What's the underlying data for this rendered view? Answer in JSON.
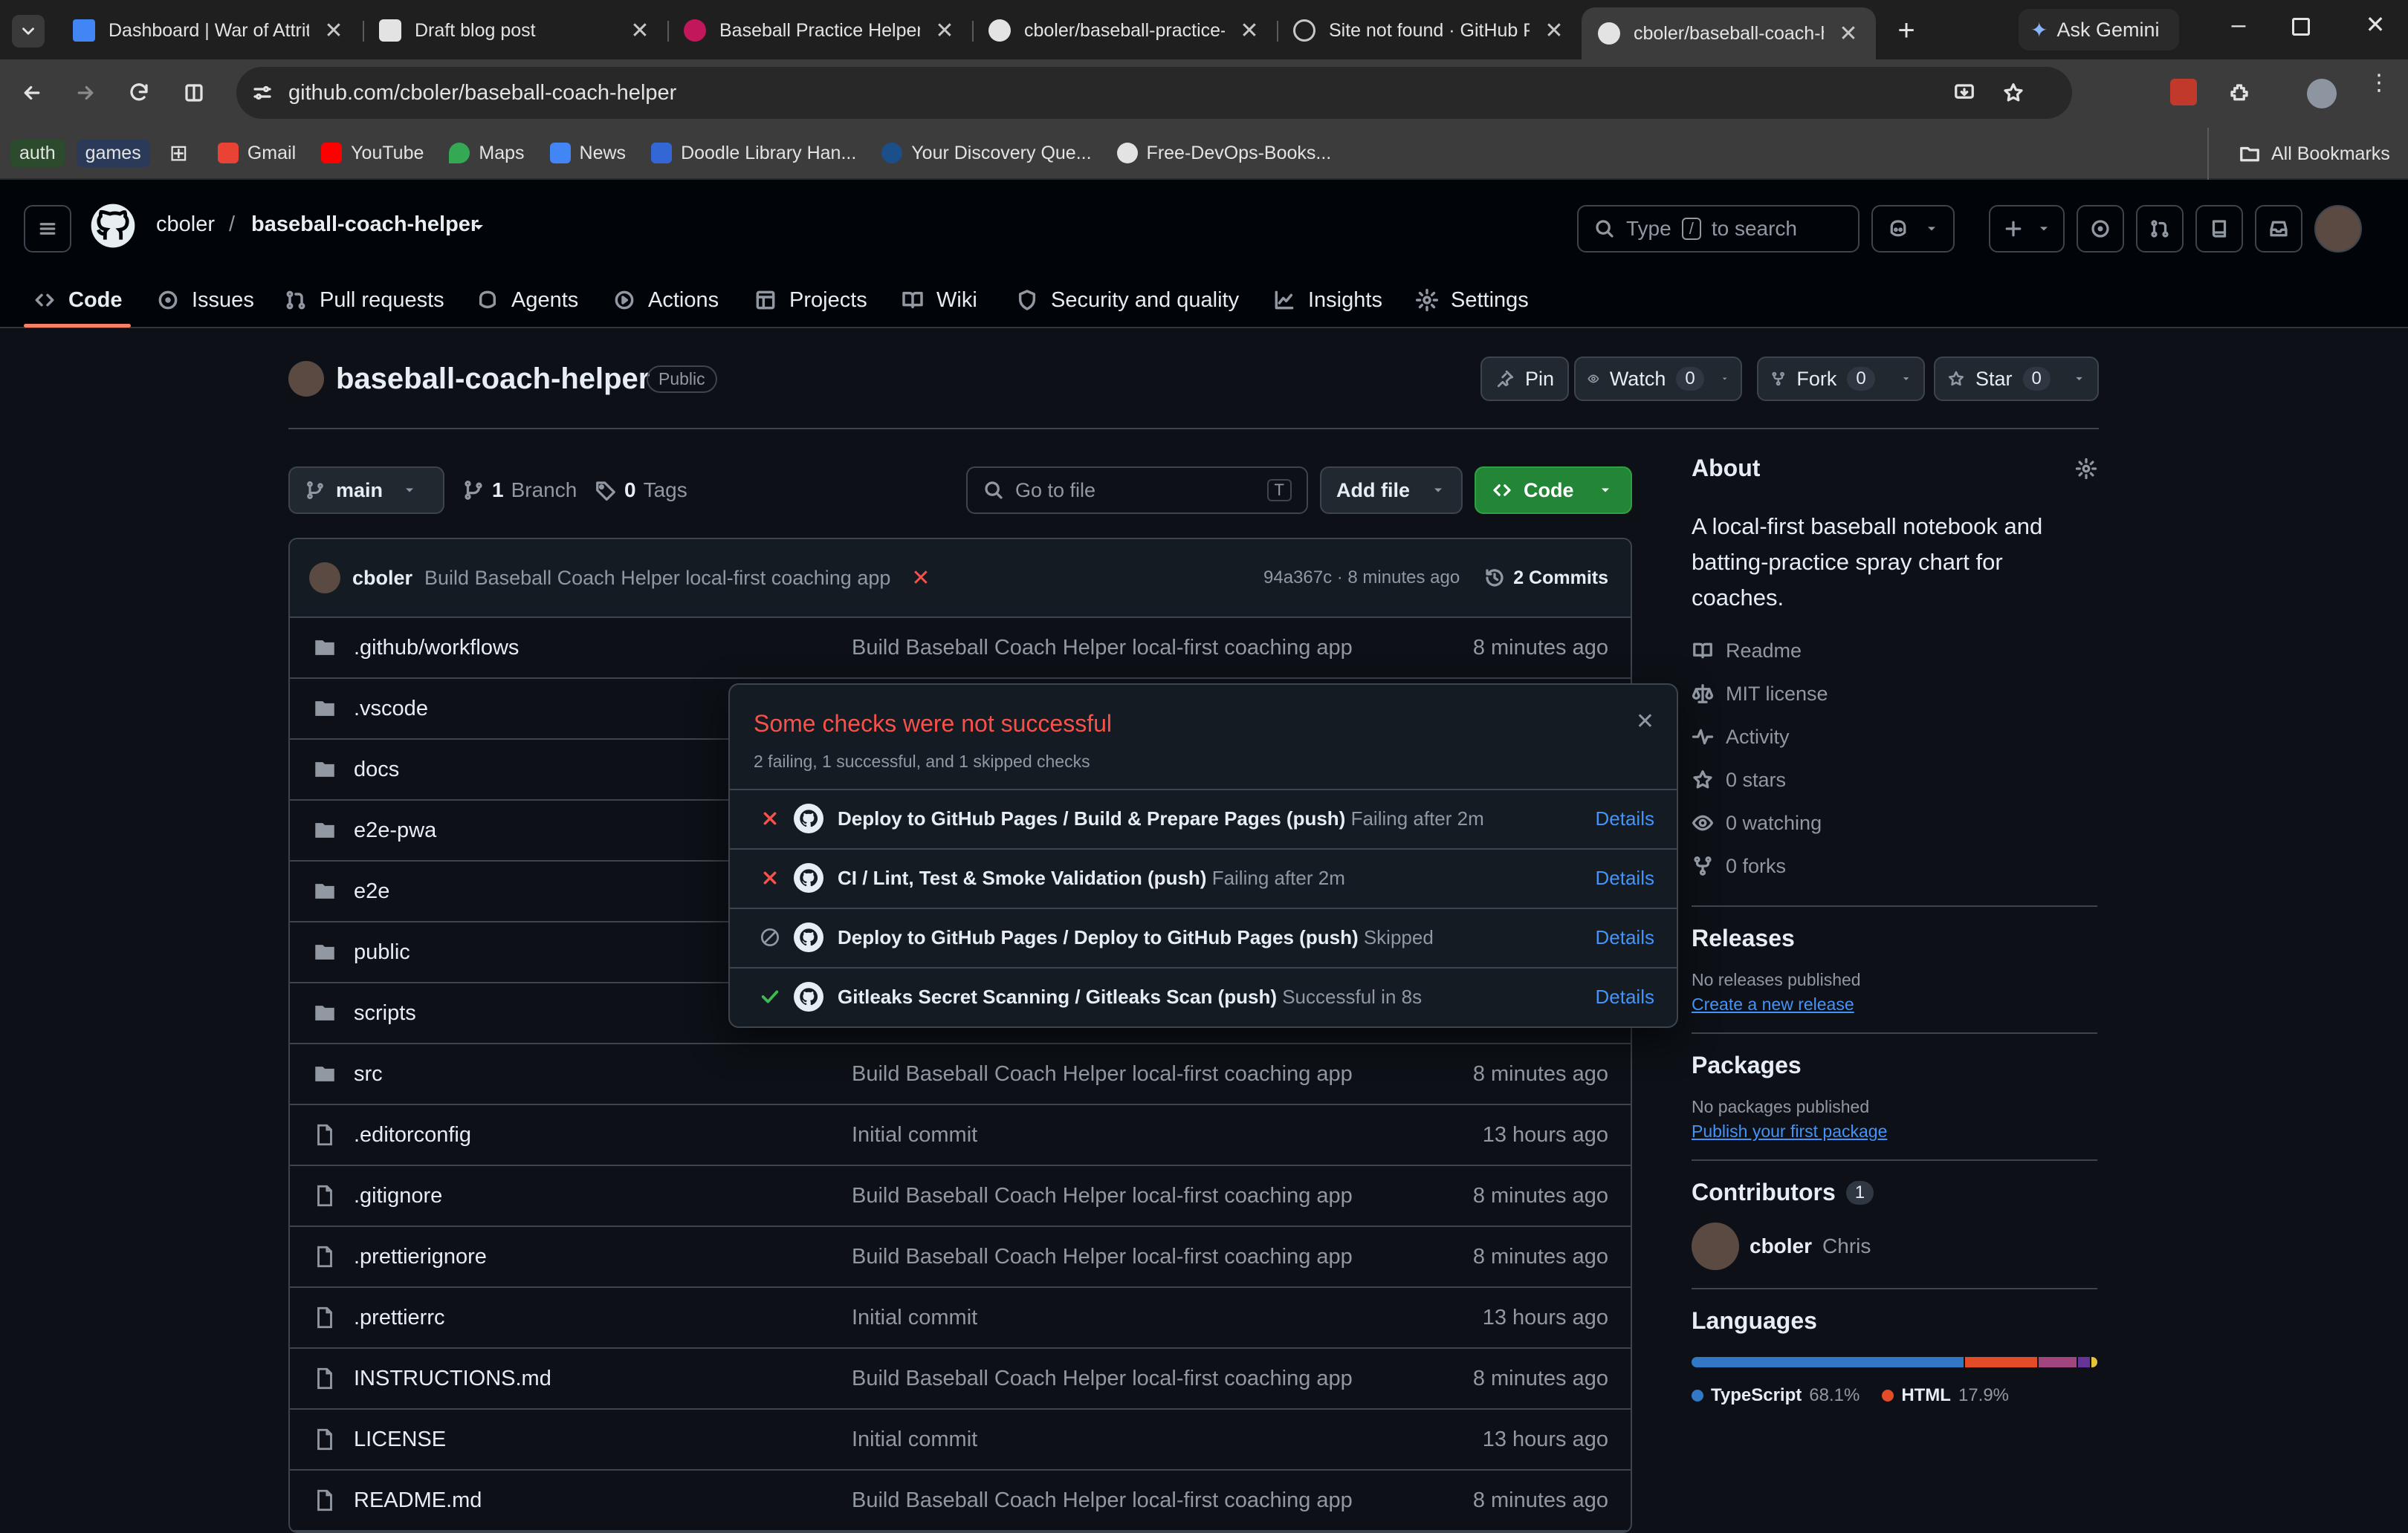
{
  "browser": {
    "tabs": [
      {
        "title": "Dashboard | War of Attrit",
        "active": false
      },
      {
        "title": "Draft blog post",
        "active": false
      },
      {
        "title": "Baseball Practice Helper",
        "active": false
      },
      {
        "title": "cboler/baseball-practice-",
        "active": false
      },
      {
        "title": "Site not found · GitHub P",
        "active": false
      },
      {
        "title": "cboler/baseball-coach-he",
        "active": true
      }
    ],
    "ask_gemini": "Ask Gemini",
    "url": "github.com/cboler/baseball-coach-helper",
    "bookmarks": {
      "chip1": "auth",
      "chip2": "games",
      "items": [
        "Gmail",
        "YouTube",
        "Maps",
        "News",
        "Doodle Library Han...",
        "Your Discovery Que...",
        "Free-DevOps-Books..."
      ],
      "all": "All Bookmarks"
    }
  },
  "github": {
    "owner": "cboler",
    "sep": "/",
    "repo": "baseball-coach-helper",
    "search_prefix": "Type",
    "search_key": "/",
    "search_suffix": "to search",
    "nav": [
      "Code",
      "Issues",
      "Pull requests",
      "Agents",
      "Actions",
      "Projects",
      "Wiki",
      "Security and quality",
      "Insights",
      "Settings"
    ]
  },
  "repo": {
    "name": "baseball-coach-helper",
    "visibility": "Public",
    "pin": "Pin",
    "watch": "Watch",
    "watch_count": "0",
    "fork": "Fork",
    "fork_count": "0",
    "star": "Star",
    "star_count": "0",
    "branch": "main",
    "branches_count": "1",
    "branches_label": "Branch",
    "tags_count": "0",
    "tags_label": "Tags",
    "go_to_file": "Go to file",
    "go_to_file_key": "T",
    "add_file": "Add file",
    "code_btn": "Code"
  },
  "commit": {
    "author": "cboler",
    "message": "Build Baseball Coach Helper local-first coaching app",
    "sha_time": "94a367c · 8 minutes ago",
    "commits": "2 Commits"
  },
  "files": [
    {
      "name": ".github/workflows",
      "type": "dir",
      "msg": "Build Baseball Coach Helper local-first coaching app",
      "date": "8 minutes ago"
    },
    {
      "name": ".vscode",
      "type": "dir",
      "msg": "",
      "date": ""
    },
    {
      "name": "docs",
      "type": "dir",
      "msg": "",
      "date": ""
    },
    {
      "name": "e2e-pwa",
      "type": "dir",
      "msg": "",
      "date": ""
    },
    {
      "name": "e2e",
      "type": "dir",
      "msg": "",
      "date": ""
    },
    {
      "name": "public",
      "type": "dir",
      "msg": "",
      "date": ""
    },
    {
      "name": "scripts",
      "type": "dir",
      "msg": "",
      "date": ""
    },
    {
      "name": "src",
      "type": "dir",
      "msg": "Build Baseball Coach Helper local-first coaching app",
      "date": "8 minutes ago"
    },
    {
      "name": ".editorconfig",
      "type": "file",
      "msg": "Initial commit",
      "date": "13 hours ago"
    },
    {
      "name": ".gitignore",
      "type": "file",
      "msg": "Build Baseball Coach Helper local-first coaching app",
      "date": "8 minutes ago"
    },
    {
      "name": ".prettierignore",
      "type": "file",
      "msg": "Build Baseball Coach Helper local-first coaching app",
      "date": "8 minutes ago"
    },
    {
      "name": ".prettierrc",
      "type": "file",
      "msg": "Initial commit",
      "date": "13 hours ago"
    },
    {
      "name": "INSTRUCTIONS.md",
      "type": "file",
      "msg": "Build Baseball Coach Helper local-first coaching app",
      "date": "8 minutes ago"
    },
    {
      "name": "LICENSE",
      "type": "file",
      "msg": "Initial commit",
      "date": "13 hours ago"
    },
    {
      "name": "README.md",
      "type": "file",
      "msg": "Build Baseball Coach Helper local-first coaching app",
      "date": "8 minutes ago"
    }
  ],
  "checks": {
    "title": "Some checks were not successful",
    "summary": "2 failing, 1 successful, and 1 skipped checks",
    "items": [
      {
        "status": "failing",
        "name": "Deploy to GitHub Pages / Build & Prepare Pages (push)",
        "detail": "Failing after 2m",
        "link": "Details"
      },
      {
        "status": "failing",
        "name": "CI / Lint, Test & Smoke Validation (push)",
        "detail": "Failing after 2m",
        "link": "Details"
      },
      {
        "status": "skipped",
        "name": "Deploy to GitHub Pages / Deploy to GitHub Pages (push)",
        "detail": "Skipped",
        "link": "Details"
      },
      {
        "status": "success",
        "name": "Gitleaks Secret Scanning / Gitleaks Scan (push)",
        "detail": "Successful in 8s",
        "link": "Details"
      }
    ]
  },
  "about": {
    "title": "About",
    "description": "A local-first baseball notebook and batting-practice spray chart for coaches.",
    "links": [
      "Readme",
      "MIT license",
      "Activity",
      "0 stars",
      "0 watching",
      "0 forks"
    ],
    "releases_title": "Releases",
    "releases_none": "No releases published",
    "releases_link": "Create a new release",
    "packages_title": "Packages",
    "packages_none": "No packages published",
    "packages_link": "Publish your first package",
    "contributors_title": "Contributors",
    "contributors_count": "1",
    "contributor_login": "cboler",
    "contributor_name": "Chris",
    "languages_title": "Languages",
    "languages": [
      {
        "name": "TypeScript",
        "pct": "68.1%",
        "value": 68.1,
        "color": "#3178c6"
      },
      {
        "name": "HTML",
        "pct": "17.9%",
        "value": 17.9,
        "color": "#e34c26"
      },
      {
        "name": "",
        "pct": "",
        "value": 9.5,
        "color": "#a0457e"
      },
      {
        "name": "",
        "pct": "",
        "value": 3.0,
        "color": "#663399"
      },
      {
        "name": "",
        "pct": "",
        "value": 1.5,
        "color": "#e5c33a"
      }
    ]
  },
  "colors": {
    "accent_green": "#238636",
    "fail_red": "#f85149",
    "success_green": "#3fb950",
    "link_blue": "#4493f8",
    "active_tab_underline": "#f78166"
  }
}
